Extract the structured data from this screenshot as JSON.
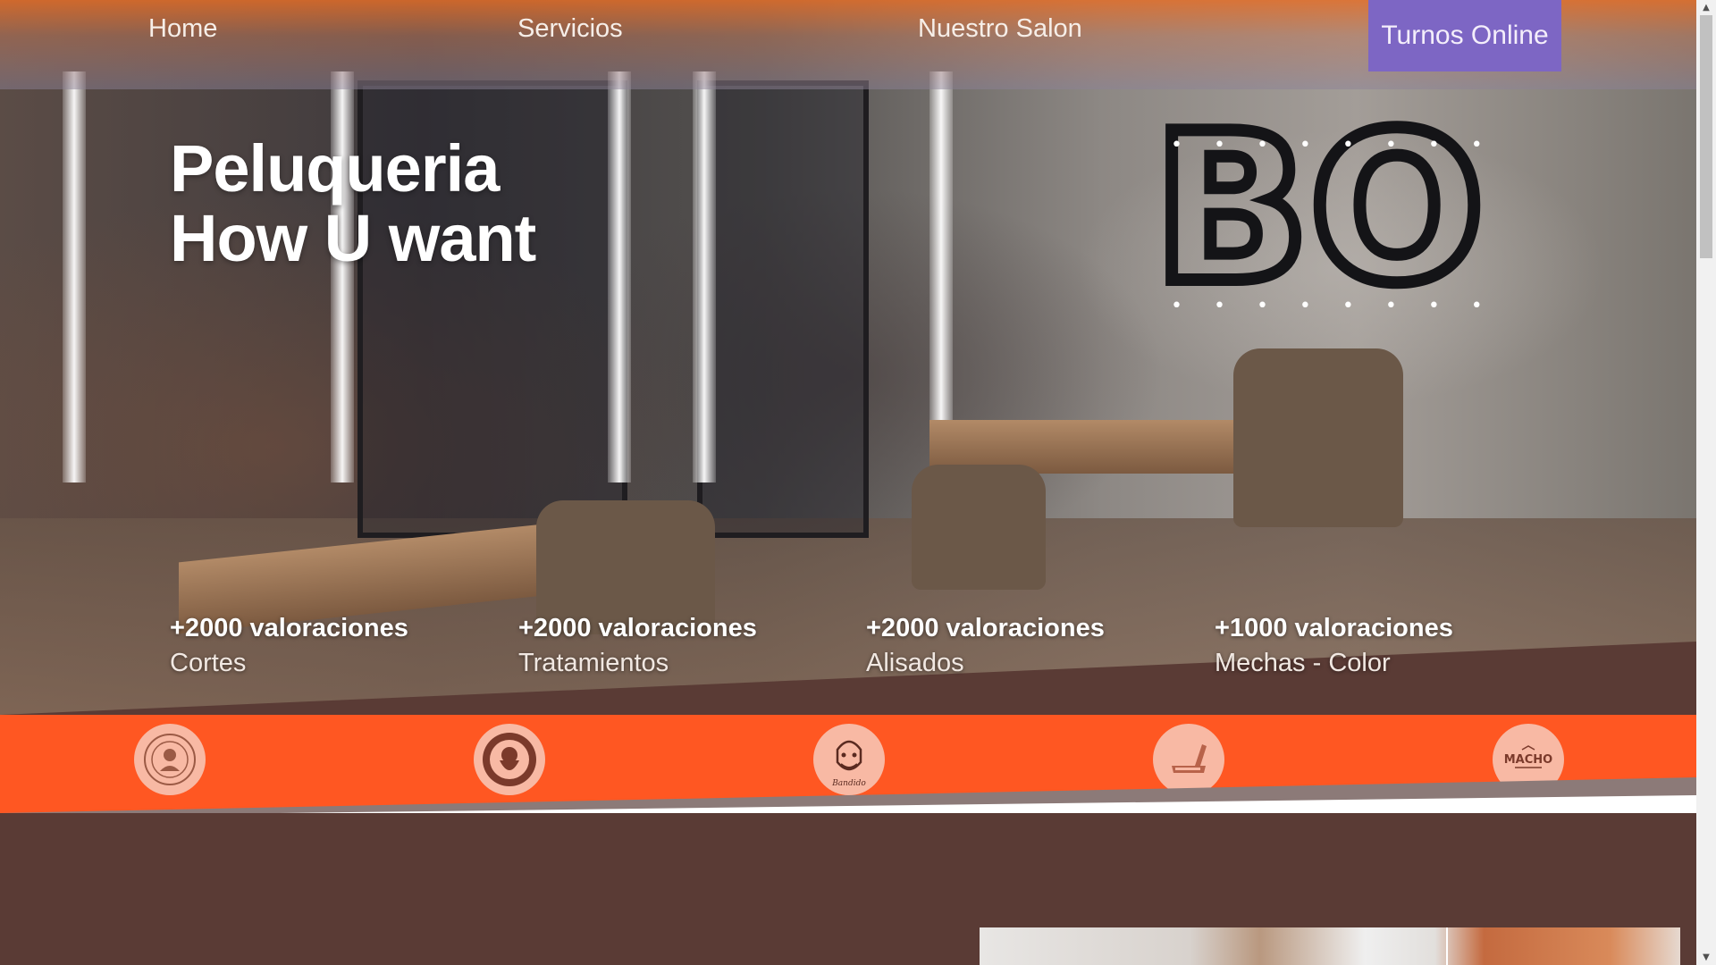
{
  "nav": {
    "items": [
      {
        "label": "Home"
      },
      {
        "label": "Servicios"
      },
      {
        "label": "Nuestro Salon"
      }
    ],
    "cta_label": "Turnos Online",
    "cta_color": "#7d66c4"
  },
  "hero": {
    "title_line1": "Peluqueria",
    "title_line2": "How U want",
    "sign_text": "BO"
  },
  "stats": [
    {
      "value": "+2000 valoraciones",
      "label": "Cortes"
    },
    {
      "value": "+2000 valoraciones",
      "label": "Tratamientos"
    },
    {
      "value": "+2000 valoraciones",
      "label": "Alisados"
    },
    {
      "value": "+1000 valoraciones",
      "label": "Mechas - Color"
    }
  ],
  "brands": [
    {
      "icon": "fast-lane-logo-icon"
    },
    {
      "icon": "bearded-man-logo-icon"
    },
    {
      "icon": "bandido-logo-icon",
      "text": "Bandido"
    },
    {
      "icon": "razor-logo-icon"
    },
    {
      "icon": "macho-logo-icon",
      "text": "MACHO"
    }
  ],
  "colors": {
    "accent_orange": "#ff5722",
    "brown": "#5a3b35",
    "brand_circle": "#f8b9a4"
  },
  "scrollbar": {
    "up_icon": "scroll-up-arrow-icon",
    "down_icon": "scroll-down-arrow-icon"
  }
}
